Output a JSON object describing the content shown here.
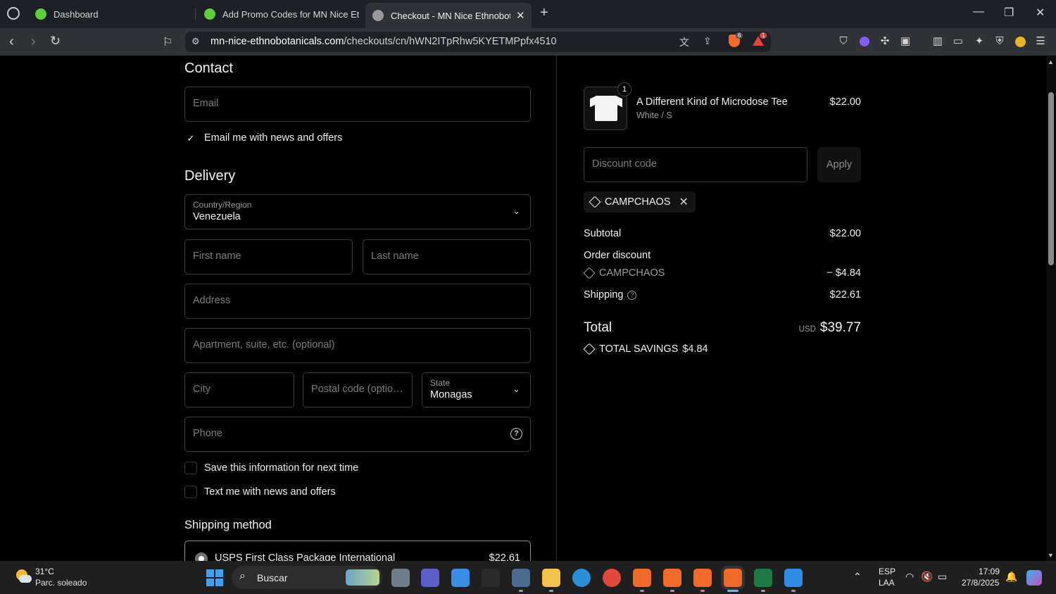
{
  "browser": {
    "tabs": [
      {
        "label": "Dashboard",
        "active": false
      },
      {
        "label": "Add Promo Codes for MN Nice Ethnobotanicals",
        "active": false
      },
      {
        "label": "Checkout - MN Nice Ethnobotanicals",
        "active": true
      }
    ],
    "url_host": "mn-nice-ethnobotanicals.com",
    "url_path": "/checkouts/cn/hWN2ITpRhw5KYETMPpfx4510",
    "brave_badge": "6",
    "alert_badge": "1"
  },
  "contact": {
    "heading": "Contact",
    "email_placeholder": "Email",
    "email_news_label": "Email me with news and offers",
    "email_news_checked": true
  },
  "delivery": {
    "heading": "Delivery",
    "country_label": "Country/Region",
    "country_value": "Venezuela",
    "first_name_placeholder": "First name",
    "last_name_placeholder": "Last name",
    "address_placeholder": "Address",
    "apartment_placeholder": "Apartment, suite, etc. (optional)",
    "city_placeholder": "City",
    "postal_placeholder": "Postal code (optional)",
    "state_label": "State",
    "state_value": "Monagas",
    "phone_placeholder": "Phone",
    "save_info_label": "Save this information for next time",
    "text_news_label": "Text me with news and offers"
  },
  "shipping": {
    "heading": "Shipping method",
    "option_name": "USPS First Class Package International",
    "option_price": "$22.61"
  },
  "summary": {
    "product_name": "A Different Kind of Microdose Tee",
    "product_variant": "White / S",
    "product_price": "$22.00",
    "quantity": "1",
    "discount_placeholder": "Discount code",
    "apply_label": "Apply",
    "applied_code": "CAMPCHAOS",
    "subtotal_label": "Subtotal",
    "subtotal_value": "$22.00",
    "order_discount_label": "Order discount",
    "discount_code": "CAMPCHAOS",
    "discount_value": "− $4.84",
    "shipping_label": "Shipping",
    "shipping_value": "$22.61",
    "total_label": "Total",
    "total_currency": "USD",
    "total_value": "$39.77",
    "savings_label": "TOTAL SAVINGS",
    "savings_value": "$4.84"
  },
  "taskbar": {
    "weather_temp": "31°C",
    "weather_desc": "Parc. soleado",
    "search_label": "Buscar",
    "lang_top": "ESP",
    "lang_bottom": "LAA",
    "time": "17:09",
    "date": "27/8/2025"
  },
  "colors": {
    "page_bg": "#000000",
    "border": "#3a3a3a",
    "brave_orange": "#f06a2a",
    "excel_green": "#1d7a44"
  }
}
